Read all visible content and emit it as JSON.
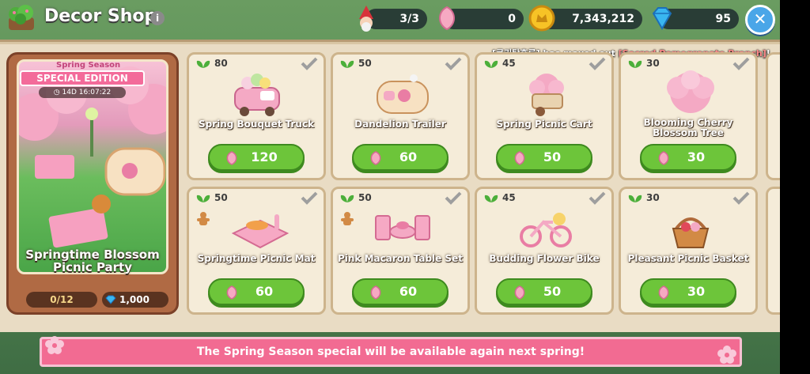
{
  "header": {
    "title": "Decor Shop",
    "info_icon": "info-icon",
    "resources": {
      "stamina": "3/3",
      "petals": "0",
      "coins": "7,343,212",
      "gems": "95"
    },
    "close_icon": "close-icon"
  },
  "notice": {
    "prefix": "[쿠키탕후루]",
    "middle": " has maxed out ",
    "item": "[Sacred Pomegranate Branch]",
    "suffix": "!"
  },
  "featured": {
    "season": "Spring Season",
    "edition": "SPECIAL EDITION",
    "timer": "14D 16:07:22",
    "name": "Springtime Blossom Picnic Party",
    "progress": "0/12",
    "gem_price": "1,000"
  },
  "items": [
    {
      "level": "80",
      "name": "Spring Bouquet Truck",
      "price": "120"
    },
    {
      "level": "50",
      "name": "Dandelion Trailer",
      "price": "60"
    },
    {
      "level": "45",
      "name": "Spring Picnic Cart",
      "price": "50"
    },
    {
      "level": "30",
      "name": "Blooming Cherry Blossom Tree",
      "price": "30"
    },
    {
      "level": "50",
      "name": "Springtime Picnic Mat",
      "price": "60"
    },
    {
      "level": "50",
      "name": "Pink Macaron Table Set",
      "price": "60"
    },
    {
      "level": "45",
      "name": "Budding Flower Bike",
      "price": "50"
    },
    {
      "level": "30",
      "name": "Pleasant Picnic Basket",
      "price": "30"
    }
  ],
  "banner": {
    "text": "The Spring Season special will be available again next spring!"
  },
  "colors": {
    "buy_button": "#6dc53a",
    "banner": "#f26b92",
    "special_banner": "#f36b9a",
    "card_bg": "#f5ecd9"
  }
}
